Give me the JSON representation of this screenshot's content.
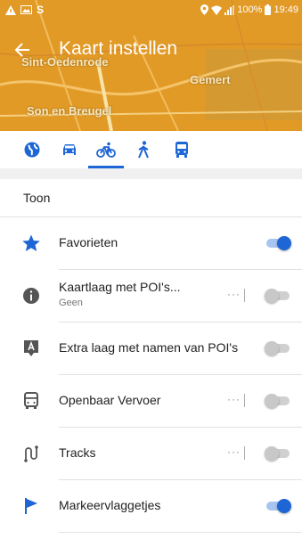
{
  "statusbar": {
    "left_text": "S",
    "battery": "100%",
    "time": "19:49"
  },
  "header": {
    "title": "Kaart instellen",
    "map_labels": [
      "Sint-Oedenrode",
      "Gemert",
      "Son en Breugel"
    ]
  },
  "tabs": [
    {
      "name": "globe-icon",
      "active": false
    },
    {
      "name": "car-icon",
      "active": false
    },
    {
      "name": "bicycle-icon",
      "active": true
    },
    {
      "name": "walking-icon",
      "active": false
    },
    {
      "name": "bus-icon",
      "active": false
    }
  ],
  "section": {
    "title": "Toon",
    "rows": [
      {
        "icon": "star-icon",
        "label": "Favorieten",
        "enabled": true
      },
      {
        "icon": "info-icon",
        "label": "Kaartlaag met POI's...",
        "sub": "Geen",
        "more": "···",
        "enabled": false
      },
      {
        "icon": "poi-labels-icon",
        "label": "Extra laag met namen van POI's",
        "enabled": false
      },
      {
        "icon": "bus-icon",
        "label": "Openbaar Vervoer",
        "more": "···",
        "enabled": false
      },
      {
        "icon": "tracks-icon",
        "label": "Tracks",
        "more": "···",
        "enabled": false
      },
      {
        "icon": "flag-icon",
        "label": "Markeervlaggetjes",
        "enabled": true
      }
    ]
  },
  "colors": {
    "accent": "#1e66d6",
    "header": "#e39a24",
    "icon_gray": "#555555"
  }
}
